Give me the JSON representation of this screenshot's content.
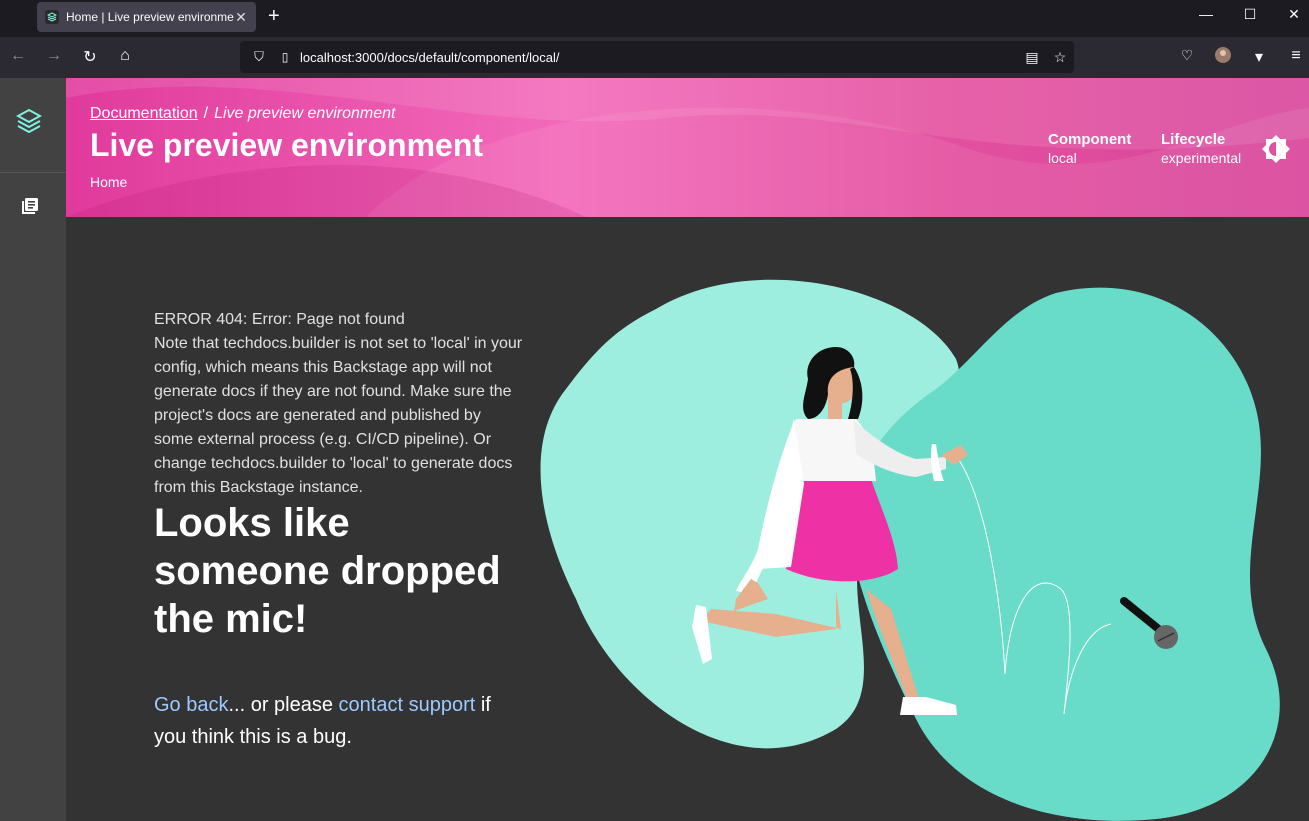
{
  "browser": {
    "tab_title": "Home | Live preview environme",
    "url": "localhost:3000/docs/default/component/local/"
  },
  "header": {
    "breadcrumb_link": "Documentation",
    "breadcrumb_separator": "/",
    "breadcrumb_current": "Live preview environment",
    "title": "Live preview environment",
    "subtitle": "Home",
    "meta": [
      {
        "label": "Component",
        "value": "local"
      },
      {
        "label": "Lifecycle",
        "value": "experimental"
      }
    ]
  },
  "error": {
    "line1": "ERROR 404: Error: Page not found",
    "note": "Note that techdocs.builder is not set to 'local' in your config, which means this Backstage app will not generate docs if they are not found. Make sure the project's docs are generated and published by some external process (e.g. CI/CD pipeline). Or change techdocs.builder to 'local' to generate docs from this Backstage instance."
  },
  "headline": "Looks like someone dropped the mic!",
  "support": {
    "go_back": "Go back",
    "middle": "... or please ",
    "contact": "contact support",
    "end": " if you think this is a bug."
  },
  "colors": {
    "header_pink": "#e03a9c",
    "link_blue": "#9cc9ff",
    "blob_light": "#9eeee0",
    "blob_teal": "#68dcc9",
    "skirt_pink": "#ee32a6"
  }
}
